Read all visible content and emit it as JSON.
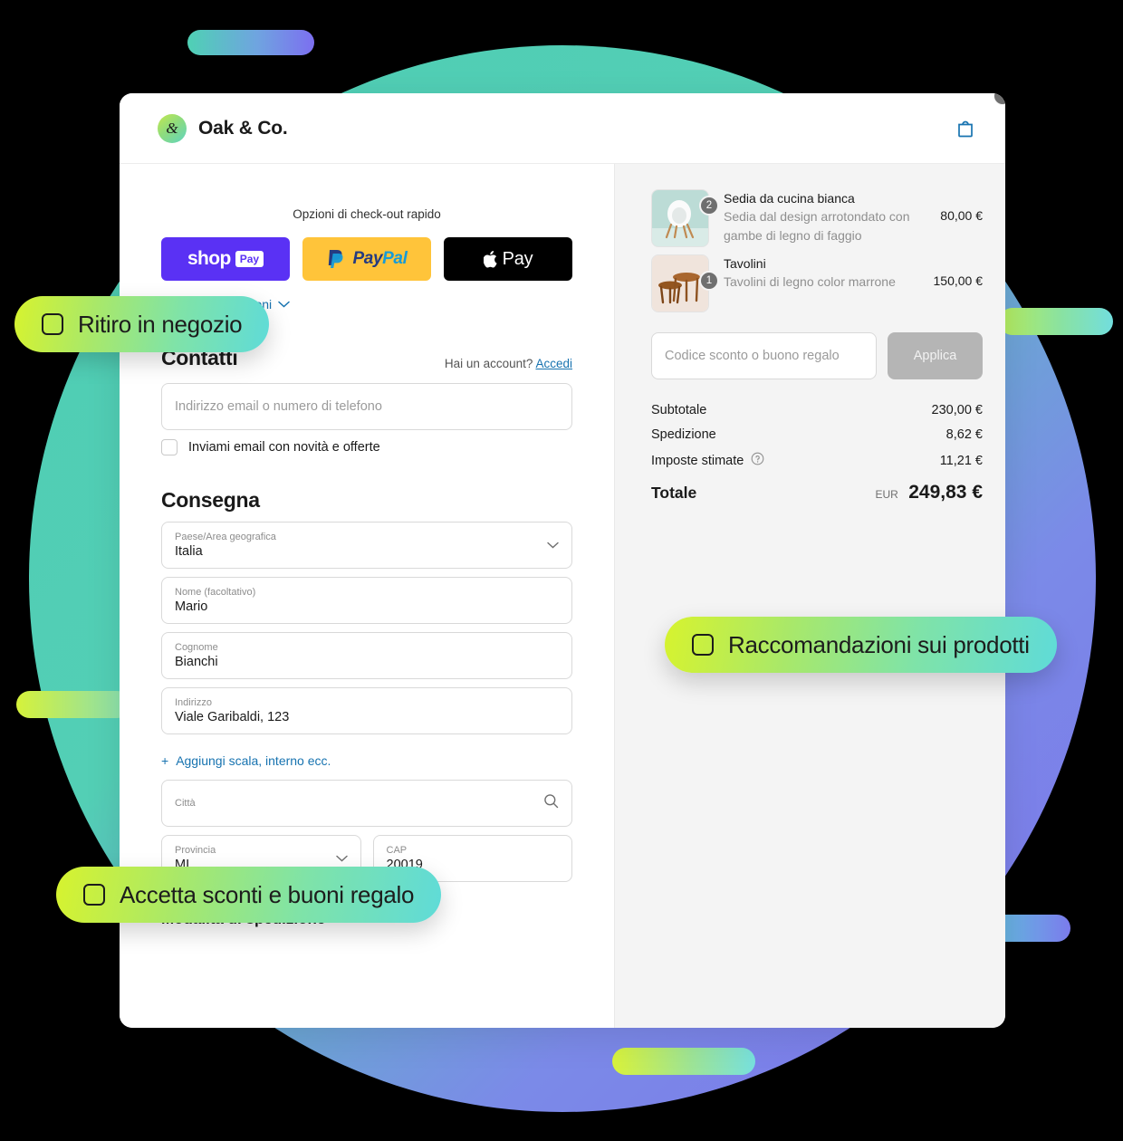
{
  "header": {
    "brand_mark_glyph": "&",
    "brand_name": "Oak & Co.",
    "cart_icon": "shopping-bag-icon"
  },
  "express": {
    "title": "Opzioni di check-out rapido",
    "buttons": [
      {
        "id": "shop-pay",
        "word": "shop",
        "tag": "Pay",
        "bg": "#5a31f4"
      },
      {
        "id": "paypal",
        "a": "Pay",
        "b": "Pal",
        "bg": "#ffc43a"
      },
      {
        "id": "apple-pay",
        "label": "Pay",
        "bg": "#000000"
      }
    ],
    "more_options": "Mostra altre opzioni"
  },
  "contacts": {
    "title": "Contatti",
    "account_prompt": "Hai un account?",
    "login_link": "Accedi",
    "email_placeholder": "Indirizzo email o numero di telefono",
    "email_value": "",
    "newsletter_label": "Inviami email con novità e offerte",
    "newsletter_checked": false
  },
  "delivery": {
    "title": "Consegna",
    "country": {
      "label": "Paese/Area geografica",
      "value": "Italia"
    },
    "first_name": {
      "label": "Nome (facoltativo)",
      "value": "Mario"
    },
    "last_name": {
      "label": "Cognome",
      "value": "Bianchi"
    },
    "address": {
      "label": "Indirizzo",
      "value": "Viale Garibaldi, 123"
    },
    "add_line_link": "Aggiungi scala, interno ecc.",
    "add_line_plus": "+",
    "city": {
      "label": "Città",
      "value": ""
    },
    "province": {
      "label": "Provincia",
      "value": "MI"
    },
    "postal": {
      "label": "CAP",
      "value": "20019"
    },
    "shipping_title": "Modalità di spedizione"
  },
  "order": {
    "items": [
      {
        "name": "Sedia da cucina bianca",
        "desc": "Sedia dal design arrotondato con gambe di legno di faggio",
        "price": "80,00 €",
        "qty": "2",
        "thumb": "white-kitchen-chair-thumbnail"
      },
      {
        "name": "Tavolini",
        "desc": "Tavolini di legno color marrone",
        "price": "150,00 €",
        "qty": "1",
        "thumb": "wooden-side-tables-thumbnail"
      }
    ],
    "discount_placeholder": "Codice sconto o buono regalo",
    "discount_value": "",
    "apply_label": "Applica",
    "summary": [
      {
        "label": "Subtotale",
        "value": "230,00 €",
        "info": false
      },
      {
        "label": "Spedizione",
        "value": "8,62 €",
        "info": false
      },
      {
        "label": "Imposte stimate",
        "value": "11,21 €",
        "info": true
      }
    ],
    "total_label": "Totale",
    "total_currency": "EUR",
    "total_value": "249,83 €"
  },
  "pills": [
    {
      "id": "pickup",
      "label": "Ritiro in negozio"
    },
    {
      "id": "recommendations",
      "label": "Raccomandazioni sui prodotti"
    },
    {
      "id": "discounts",
      "label": "Accetta sconti e buoni regalo"
    }
  ],
  "colors": {
    "accent_link": "#1773b0",
    "pill_gradient_start": "#d7f32e",
    "pill_gradient_end": "#5fdbd8",
    "circle_start": "#4ecdb4",
    "circle_end": "#7c73ea",
    "shop_pay": "#5a31f4",
    "paypal": "#ffc43a"
  }
}
